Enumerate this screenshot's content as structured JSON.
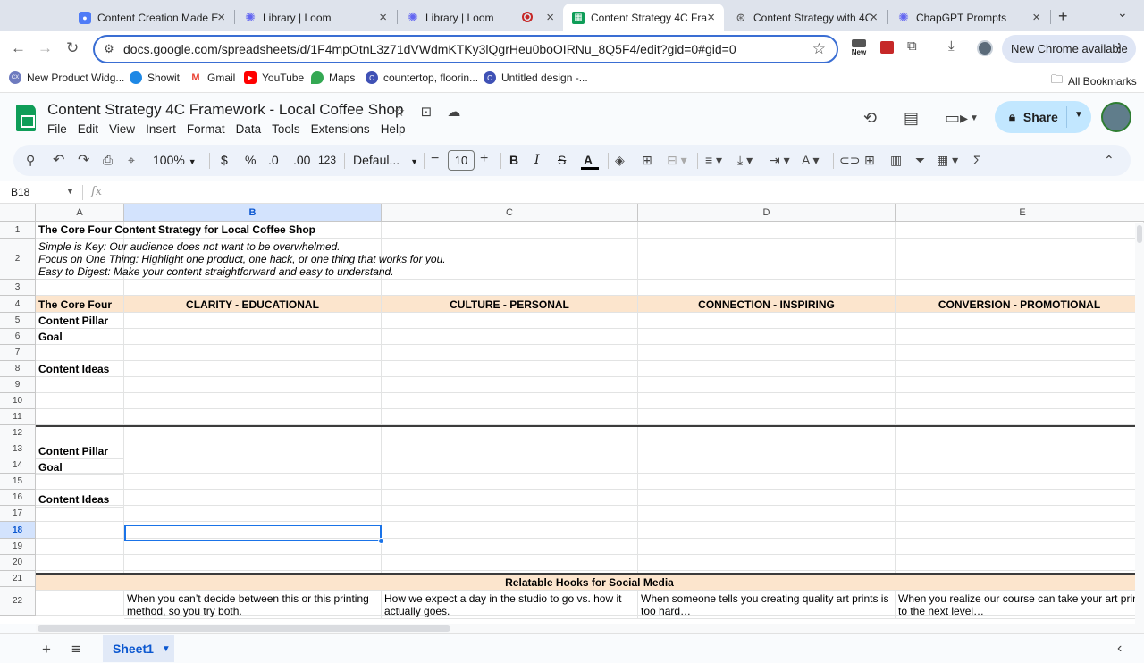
{
  "browser": {
    "tabs": [
      {
        "title": "Content Creation Made E",
        "icon": "loom-tab-icon",
        "color": "#4f7cf7"
      },
      {
        "title": "Library | Loom",
        "icon": "loom-tab-icon",
        "color": "#6366f1"
      },
      {
        "title": "Library | Loom",
        "icon": "loom-tab-icon",
        "color": "#6366f1"
      },
      {
        "title": "Content Strategy 4C Fra",
        "icon": "sheets-tab-icon",
        "color": "#0f9d58"
      },
      {
        "title": "Content Strategy with 4C",
        "icon": "chatgpt-tab-icon",
        "color": "#555555"
      },
      {
        "title": "ChapGPT Prompts",
        "icon": "loom-tab-icon",
        "color": "#6366f1"
      }
    ],
    "url": "docs.google.com/spreadsheets/d/1F4mpOtnL3z71dVWdmKTKy3lQgrHeu0boOIRNu_8Q5F4/edit?gid=0#gid=0",
    "new_badge": "New",
    "update_label": "New Chrome available",
    "bookmarks": [
      {
        "label": "New Product Widg...",
        "color": "#6e7bbf",
        "badge": "CX"
      },
      {
        "label": "Showit",
        "color": "#1e88e5",
        "badge": ""
      },
      {
        "label": "Gmail",
        "color": "#ea4335",
        "badge": "M"
      },
      {
        "label": "YouTube",
        "color": "#ff0000",
        "badge": "▶"
      },
      {
        "label": "Maps",
        "color": "#34a853",
        "badge": ""
      },
      {
        "label": "countertop, floorin...",
        "color": "#3f51b5",
        "badge": "C"
      },
      {
        "label": "Untitled design -...",
        "color": "#3f51b5",
        "badge": "C"
      }
    ],
    "all_bookmarks": "All Bookmarks"
  },
  "doc": {
    "title": "Content Strategy 4C Framework - Local Coffee Shop",
    "menu": [
      "File",
      "Edit",
      "View",
      "Insert",
      "Format",
      "Data",
      "Tools",
      "Extensions",
      "Help"
    ],
    "share_label": "Share"
  },
  "toolbar": {
    "zoom": "100%",
    "currency": "$",
    "percent": "%",
    "dec_decrease": ".0",
    "dec_increase": ".00",
    "number_format": "123",
    "font": "Defaul...",
    "font_size": "10",
    "minus": "−",
    "plus": "+"
  },
  "formula_bar": {
    "cell_ref": "B18",
    "fx": "fx"
  },
  "sheet": {
    "columns": [
      "A",
      "B",
      "C",
      "D",
      "E"
    ],
    "selected_column": "B",
    "row_numbers": [
      "1",
      "2",
      "3",
      "4",
      "5",
      "6",
      "7",
      "8",
      "9",
      "10",
      "11",
      "12",
      "13",
      "14",
      "15",
      "16",
      "17",
      "18",
      "19",
      "20",
      "21",
      "22"
    ],
    "selected_row": "18",
    "cells": {
      "a1": "The Core Four Content Strategy for Local Coffee Shop",
      "a2_line1": "Simple is Key: Our audience does not want to be overwhelmed.",
      "a2_line2": "Focus on One Thing: Highlight one product, one hack, or one thing that works for you.",
      "a2_line3": "Easy to Digest: Make your content straightforward and easy to understand.",
      "a4": "The Core Four",
      "b4": "CLARITY - EDUCATIONAL",
      "c4": "CULTURE - PERSONAL",
      "d4": "CONNECTION - INSPIRING",
      "e4": "CONVERSION - PROMOTIONAL",
      "a5": "Content Pillar",
      "a6": "Goal",
      "a8": "Content Ideas",
      "a13": "Content Pillar",
      "a14": "Goal",
      "a16": "Content Ideas",
      "a21": "Relatable Hooks for Social Media",
      "b22_line1": "When you can’t decide between this or this printing",
      "b22_line2": "method, so you try both.",
      "c22_line1": "How we expect a day in the studio to go vs. how it",
      "c22_line2": "actually goes.",
      "d22_line1": "When someone tells you creating quality art prints is",
      "d22_line2": "too hard…",
      "e22_line1": "When you realize our course can take your art prints",
      "e22_line2": "to the next level…"
    },
    "header_fill": "#fce5cd",
    "selection_color": "#1a73e8"
  },
  "sheet_tabs": {
    "active": "Sheet1"
  }
}
